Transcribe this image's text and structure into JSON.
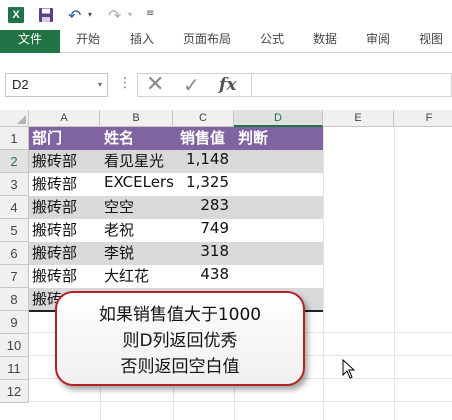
{
  "quick_access": {
    "app_icon": "excel-icon",
    "save_icon": "save-icon",
    "undo_icon": "undo-icon",
    "redo_icon": "redo-icon",
    "undo_glyph": "↶",
    "redo_glyph": "↷",
    "dropdown_glyph": "▾",
    "customize_glyph": "≡",
    "app_letter": "X"
  },
  "ribbon": {
    "tabs": [
      "文件",
      "开始",
      "插入",
      "页面布局",
      "公式",
      "数据",
      "审阅",
      "视图"
    ],
    "active_tab": "文件",
    "accent": "#217346"
  },
  "formula_bar": {
    "name_box": "D2",
    "name_box_dropdown": "▾",
    "dots": "⋮",
    "cancel_glyph": "✕",
    "enter_glyph": "✓",
    "fx_label": "fx",
    "formula": ""
  },
  "grid": {
    "columns": [
      "A",
      "B",
      "C",
      "D",
      "E",
      "F"
    ],
    "selected_column": "D",
    "rows": [
      "1",
      "2",
      "3",
      "4",
      "5",
      "6",
      "7",
      "8",
      "9",
      "10",
      "11",
      "12"
    ],
    "selected_row": "2",
    "header": {
      "dept": "部门",
      "name": "姓名",
      "sales": "销售值",
      "judge": "判断"
    },
    "records": [
      {
        "dept": "搬砖部",
        "name": "看见星光",
        "sales": "1,148",
        "judge": ""
      },
      {
        "dept": "搬砖部",
        "name": "EXCELers",
        "sales": "1,325",
        "judge": ""
      },
      {
        "dept": "搬砖部",
        "name": "空空",
        "sales": "283",
        "judge": ""
      },
      {
        "dept": "搬砖部",
        "name": "老祝",
        "sales": "749",
        "judge": ""
      },
      {
        "dept": "搬砖部",
        "name": "李锐",
        "sales": "318",
        "judge": ""
      },
      {
        "dept": "搬砖部",
        "name": "大红花",
        "sales": "438",
        "judge": ""
      },
      {
        "dept": "搬砖",
        "name": "",
        "sales": "",
        "judge": ""
      }
    ],
    "header_color": "#8064a2",
    "band_color": "#d9d9d9"
  },
  "callout": {
    "lines": [
      "如果销售值大于1000",
      "则D列返回优秀",
      "否则返回空白值"
    ],
    "border_color": "#b22222"
  }
}
